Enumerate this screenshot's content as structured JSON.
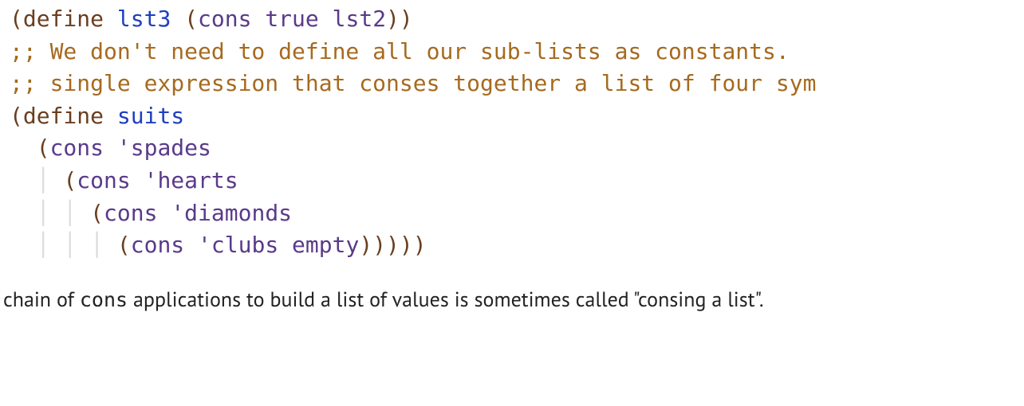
{
  "code": {
    "line1": {
      "p_open": "(",
      "kw": "define",
      "sp1": " ",
      "name": "lst3",
      "sp2": " ",
      "p_open2": "(",
      "cons": "cons",
      "sp3": " ",
      "true": "true",
      "sp4": " ",
      "lst2": "lst2",
      "p_close": "))"
    },
    "line2": ";; We don't need to define all our sub-lists as constants.",
    "line3": ";; single expression that conses together a list of four sym",
    "line4": {
      "p_open": "(",
      "kw": "define",
      "sp": " ",
      "name": "suits"
    },
    "line5": {
      "indent": "  ",
      "p_open": "(",
      "cons": "cons",
      "sp": " ",
      "quote": "'spades"
    },
    "line6": {
      "indent_plain": "  ",
      "indent_guide": "│ ",
      "p_open": "(",
      "cons": "cons",
      "sp": " ",
      "quote": "'hearts"
    },
    "line7": {
      "indent_plain": "  ",
      "indent_guide": "│ │ ",
      "p_open": "(",
      "cons": "cons",
      "sp": " ",
      "quote": "'diamonds"
    },
    "line8": {
      "indent_plain": "  ",
      "indent_guide": "│ │ │ ",
      "p_open": "(",
      "cons": "cons",
      "sp": " ",
      "quote": "'clubs",
      "sp2": " ",
      "empty": "empty",
      "p_close": ")))))"
    }
  },
  "prose": {
    "pre": "chain of ",
    "mono": "cons",
    "post": " applications to build a list of values is sometimes called \"consing a list\"."
  }
}
